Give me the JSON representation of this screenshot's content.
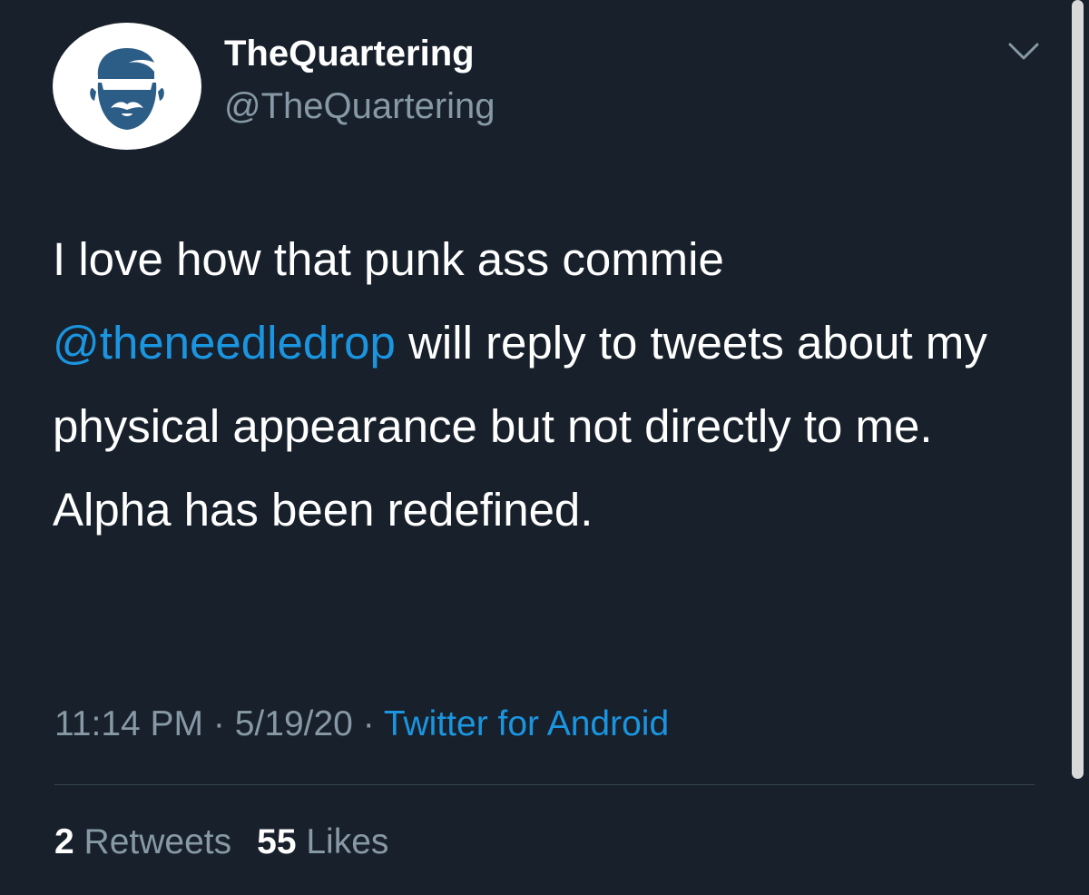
{
  "author": {
    "display_name": "TheQuartering",
    "handle": "@TheQuartering",
    "avatar_icon": "bearded-man-icon"
  },
  "tweet": {
    "text_before": "I love how that punk ass commie ",
    "mention": "@theneedledrop",
    "text_after": " will reply to tweets about my physical appearance but not directly to me. Alpha has been redefined."
  },
  "meta": {
    "time": "11:14 PM",
    "separator": "·",
    "date": "5/19/20",
    "source": "Twitter for Android"
  },
  "stats": {
    "retweets_count": "2",
    "retweets_label": "Retweets",
    "likes_count": "55",
    "likes_label": "Likes"
  },
  "colors": {
    "background": "#17202b",
    "accent": "#1b95e0",
    "secondary_text": "#8899a6",
    "avatar_icon": "#2c5d86"
  }
}
